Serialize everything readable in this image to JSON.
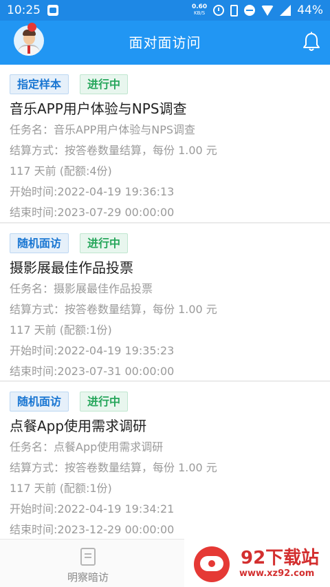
{
  "status_bar": {
    "time": "10:25",
    "speed_value": "0.60",
    "speed_unit": "KB/S",
    "battery": "44%"
  },
  "header": {
    "title": "面对面访问"
  },
  "tasks": [
    {
      "type_tag": "指定样本",
      "status_tag": "进行中",
      "title": "音乐APP用户体验与NPS调查",
      "task_name_line": "任务名：音乐APP用户体验与NPS调查",
      "settlement_line": "结算方式：按答卷数量结算，每份 1.00 元",
      "age_line": "117 天前 (配额:4份)",
      "start_line": "开始时间:2022-04-19 19:36:13",
      "end_line": "结束时间:2023-07-29 00:00:00"
    },
    {
      "type_tag": "随机面访",
      "status_tag": "进行中",
      "title": "摄影展最佳作品投票",
      "task_name_line": "任务名：摄影展最佳作品投票",
      "settlement_line": "结算方式：按答卷数量结算，每份 1.00 元",
      "age_line": "117 天前 (配额:1份)",
      "start_line": "开始时间:2022-04-19 19:35:23",
      "end_line": "结束时间:2023-07-31 00:00:00"
    },
    {
      "type_tag": "随机面访",
      "status_tag": "进行中",
      "title": "点餐App使用需求调研",
      "task_name_line": "任务名：点餐App使用需求调研",
      "settlement_line": "结算方式：按答卷数量结算，每份 1.00 元",
      "age_line": "117 天前 (配额:1份)",
      "start_line": "开始时间:2022-04-19 19:34:21",
      "end_line": "结束时间:2023-12-29 00:00:00"
    }
  ],
  "bottom_nav": {
    "tab_label": "明察暗访"
  },
  "watermark": {
    "title": "92下载站",
    "url": "www.xz92.com"
  },
  "colors": {
    "primary": "#2196f3",
    "tag_blue": "#1976d2",
    "tag_green": "#26a65b",
    "watermark_red": "#d32f2f"
  },
  "icons": {
    "header_right": "bell-icon",
    "header_left": "avatar",
    "bottom_tab": "document-icon"
  }
}
